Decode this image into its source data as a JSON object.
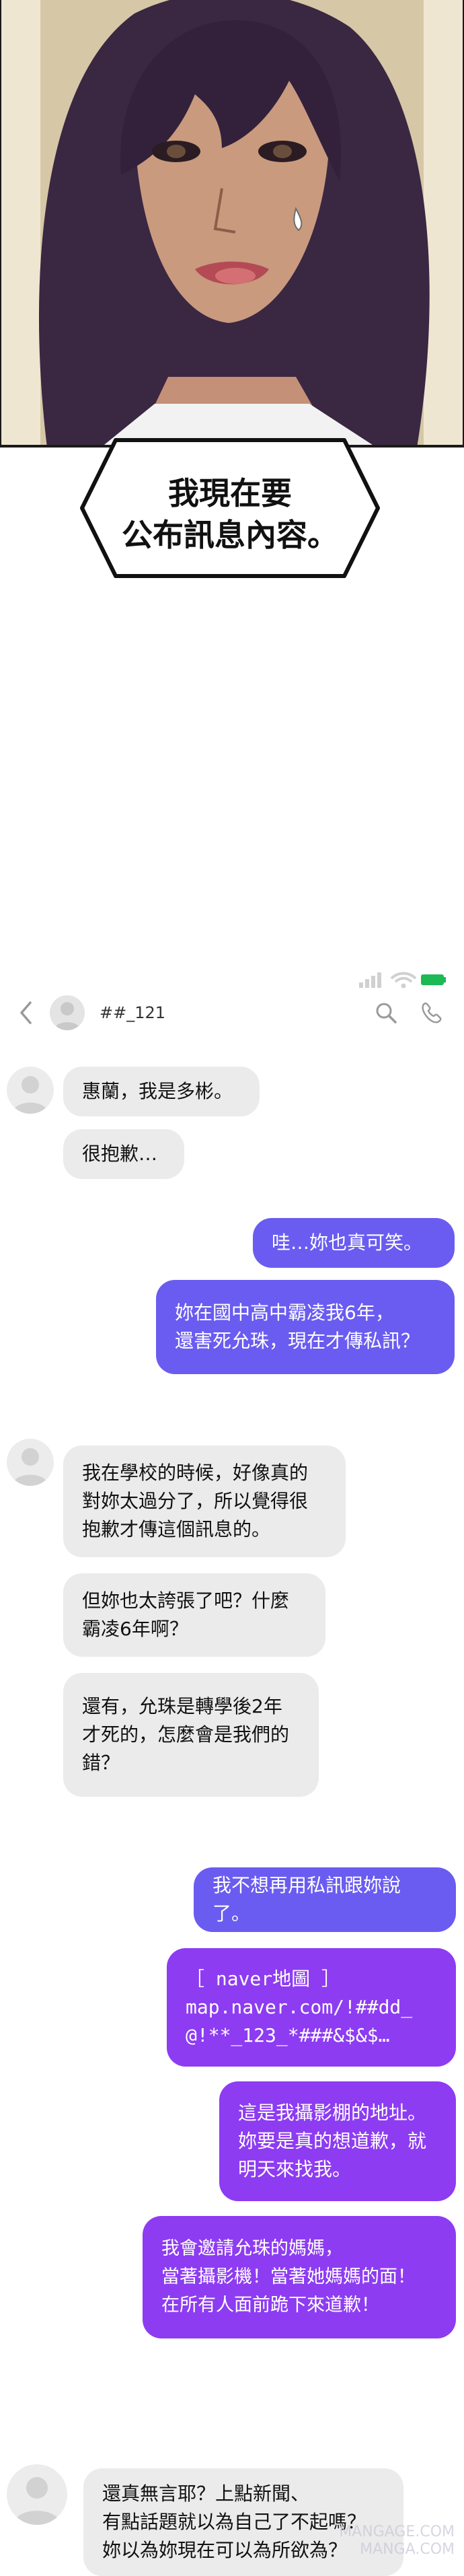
{
  "speech_bubble": {
    "lines": [
      "我現在要",
      "公布訊息內容。"
    ]
  },
  "chat": {
    "contact_name": "##_121",
    "icons": {
      "back": "chevron-left-icon",
      "avatar": "avatar-icon",
      "search": "search-icon",
      "call": "phone-icon",
      "signal": "signal-icon",
      "wifi": "wifi-icon",
      "battery": "battery-icon"
    },
    "colors": {
      "incoming": "#ebebeb",
      "outgoing_blue": "#6a5cf0",
      "outgoing_purple": "#8d3cf2",
      "battery": "#1db954"
    },
    "messages": [
      {
        "from": "them",
        "lines": [
          "惠蘭，我是多彬。"
        ]
      },
      {
        "from": "them",
        "lines": [
          "很抱歉…"
        ]
      },
      {
        "from": "me",
        "lines": [
          "哇…妳也真可笑。"
        ]
      },
      {
        "from": "me",
        "lines": [
          "妳在國中高中霸凌我6年，",
          "還害死允珠，現在才傳私訊？"
        ]
      },
      {
        "from": "them",
        "lines": [
          "我在學校的時候，好像真的",
          "對妳太過分了，所以覺得很",
          "抱歉才傳這個訊息的。"
        ]
      },
      {
        "from": "them",
        "lines": [
          "但妳也太誇張了吧？什麼",
          "霸凌6年啊？"
        ]
      },
      {
        "from": "them",
        "lines": [
          "還有，允珠是轉學後2年",
          "才死的，怎麼會是我們的",
          "錯？"
        ]
      },
      {
        "from": "me",
        "lines": [
          "我不想再用私訊跟妳說了。"
        ]
      },
      {
        "from": "me",
        "lines": [
          "［ naver地圖 ］",
          "map.naver.com/!##dd_",
          "@!**_123_*###&$&$…"
        ]
      },
      {
        "from": "me",
        "lines": [
          "這是我攝影棚的地址。",
          "妳要是真的想道歉，就",
          "明天來找我。"
        ]
      },
      {
        "from": "me",
        "lines": [
          "我會邀請允珠的媽媽，",
          "當著攝影機！當著她媽媽的面！",
          "在所有人面前跪下來道歉！"
        ]
      },
      {
        "from": "them",
        "lines": [
          "還真無言耶？上點新聞、",
          "有點話題就以為自己了不起嗎？",
          "妳以為妳現在可以為所欲為？"
        ]
      }
    ]
  },
  "watermark": {
    "line1": "MANGAGE.COM",
    "line2": "MANGA.COM"
  }
}
